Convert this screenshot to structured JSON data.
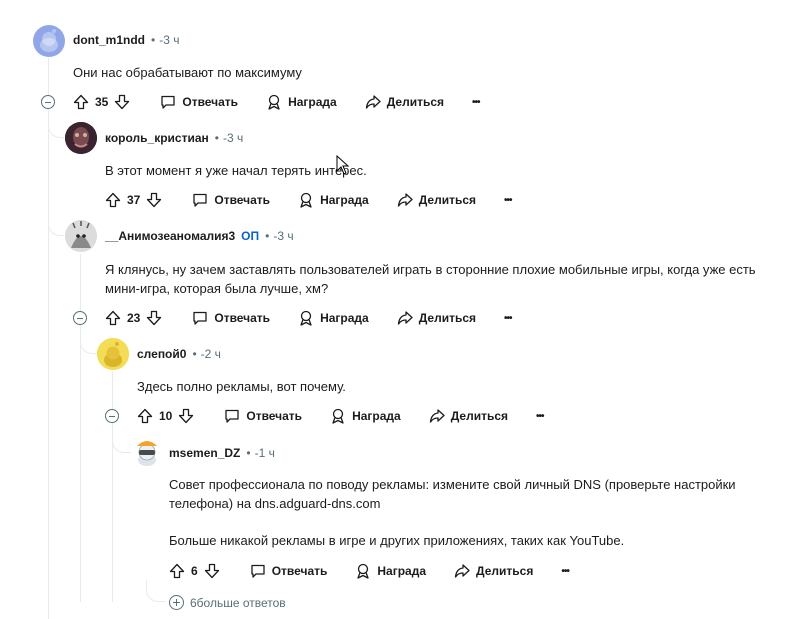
{
  "actions": {
    "reply": "Отвечать",
    "award": "Награда",
    "share": "Делиться",
    "more": "•••"
  },
  "comments": [
    {
      "author": "dont_m1ndd",
      "time": "-3 ч",
      "body": "Они нас обрабатывают по максимуму",
      "votes": "35"
    },
    {
      "author": "король_кристиан",
      "time": "-3 ч",
      "body": "В этот момент я уже начал терять интерес.",
      "votes": "37"
    },
    {
      "author": "__Анимозеаномалия3",
      "op_label": "ОП",
      "time": "-3 ч",
      "body": "Я клянусь, ну зачем заставлять пользователей играть в сторонние плохие мобильные игры, когда уже есть мини-игра, которая была лучше, хм?",
      "votes": "23"
    },
    {
      "author": "слепой0",
      "time": "-2 ч",
      "body": "Здесь полно рекламы, вот почему.",
      "votes": "10"
    },
    {
      "author": "msemen_DZ",
      "time": "-1 ч",
      "body": "Совет профессионала по поводу рекламы: измените свой личный DNS (проверьте настройки телефона) на dns.adguard-dns.com",
      "body2": "Больше никакой рекламы в игре и других приложениях, таких как YouTube.",
      "votes": "6"
    }
  ],
  "more_replies": "6больше ответов",
  "separator": "•",
  "colors": {
    "link": "#0a63c9",
    "muted": "#576f76",
    "thread_line": "#e5ebee"
  }
}
